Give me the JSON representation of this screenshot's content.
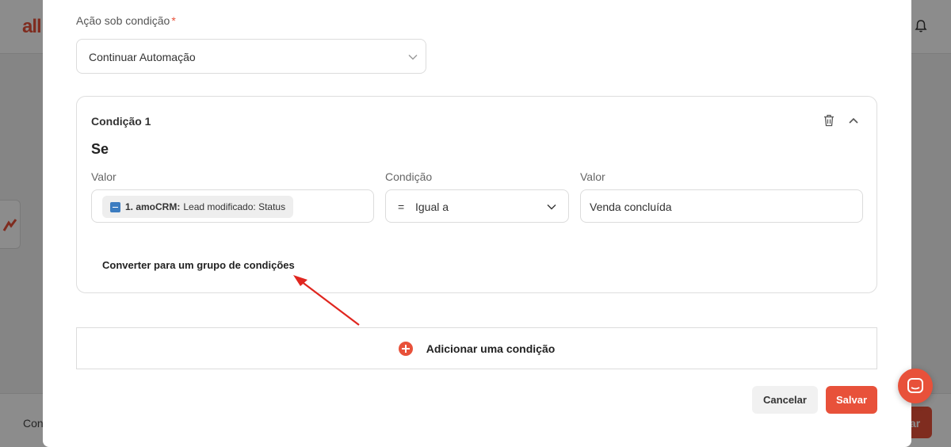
{
  "background": {
    "logo_text": "all",
    "footer_text": "Con",
    "footer_button_label": "ar"
  },
  "modal": {
    "action_label": "Ação sob condição",
    "required_mark": "*",
    "action_value": "Continuar Automação",
    "condition_card": {
      "title": "Condição 1",
      "if_label": "Se",
      "columns": {
        "value_label": "Valor",
        "condition_label": "Condição",
        "value2_label": "Valor"
      },
      "value_chip": {
        "icon": "amocrm-icon",
        "source": "1. amoCRM:",
        "field": "Lead modificado: Status"
      },
      "operator_symbol": "=",
      "operator_label": "Igual a",
      "compare_value": "Venda concluída",
      "convert_link": "Converter para um grupo de condições"
    },
    "add_condition_label": "Adicionar uma condição",
    "cancel_label": "Cancelar",
    "save_label": "Salvar"
  },
  "colors": {
    "accent": "#e8513a",
    "annotation_arrow": "#e0261f"
  }
}
